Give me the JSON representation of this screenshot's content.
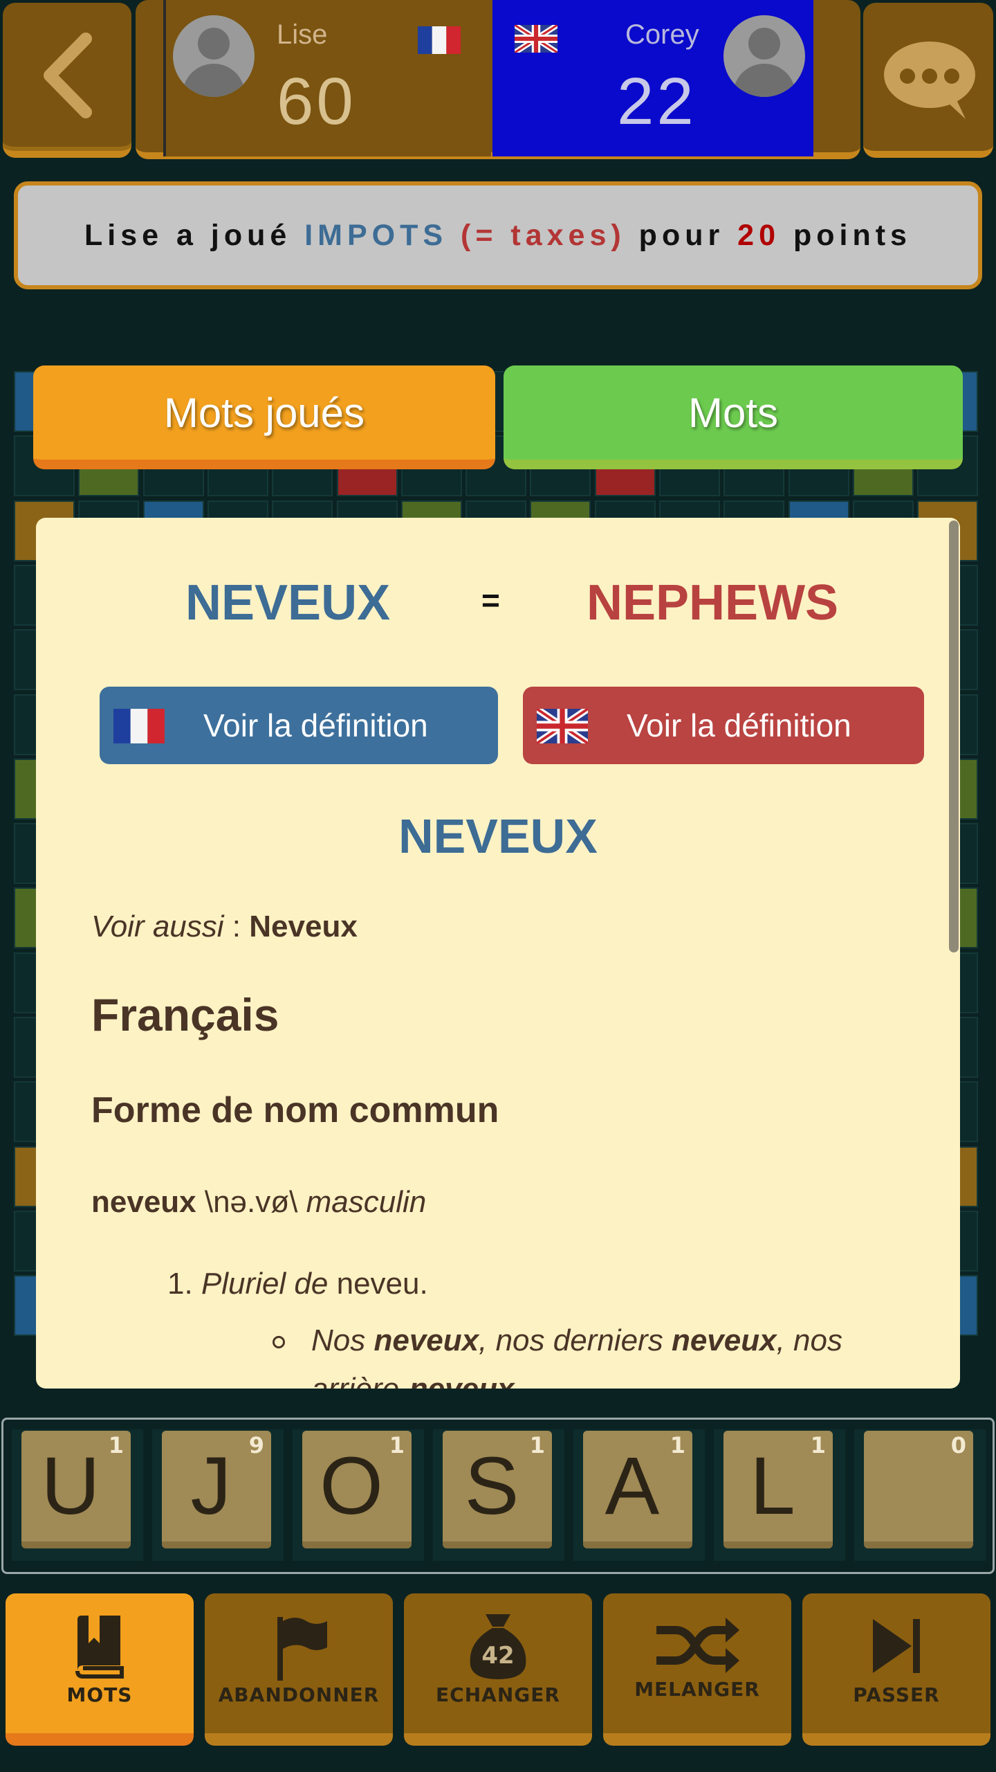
{
  "header": {
    "player1": {
      "name": "Lise",
      "score": "60",
      "flag": "fr-flag"
    },
    "player2": {
      "name": "Corey",
      "score": "22",
      "flag": "uk-flag"
    },
    "colors": {
      "player1_bg": "#7a5410",
      "player2_bg": "#0a0acc"
    }
  },
  "banner": {
    "prefix": "Lise a joué",
    "word": "IMPOTS",
    "meaning": "(= taxes)",
    "middle": "pour",
    "points": "20",
    "suffix": "points"
  },
  "tabs": {
    "played": "Mots joués",
    "words": "Mots"
  },
  "modal": {
    "word_fr": "NEVEUX",
    "equals": "=",
    "word_en": "NEPHEWS",
    "def_fr_label": "Voir la définition",
    "def_en_label": "Voir la définition",
    "def_title": "NEVEUX",
    "see_also_label": "Voir aussi",
    "see_also_sep": " : ",
    "see_also_word": "Neveux",
    "lang_heading": "Français",
    "form_heading": "Forme de nom commun",
    "entry_word": "neveux",
    "entry_pron": " \\nə.vø\\ ",
    "entry_gender": "masculin",
    "sense_num": "1.",
    "sense_lead": "Pluriel de",
    "sense_word": " neveu.",
    "ex_1": "Nos ",
    "ex_2": "neveux",
    "ex_3": ", nos derniers ",
    "ex_4": "neveux",
    "ex_5": ", nos arrière-",
    "ex_6": "neveux",
    "ex_7": "."
  },
  "rack": [
    {
      "letter": "U",
      "points": "1"
    },
    {
      "letter": "J",
      "points": "9"
    },
    {
      "letter": "O",
      "points": "1"
    },
    {
      "letter": "S",
      "points": "1"
    },
    {
      "letter": "A",
      "points": "1"
    },
    {
      "letter": "L",
      "points": "1"
    },
    {
      "letter": "",
      "points": "0"
    }
  ],
  "nav": {
    "words": "MOTS",
    "abandon": "ABANDONNER",
    "exchange": "ECHANGER",
    "bag_count": "42",
    "shuffle": "MELANGER",
    "pass": "PASSER"
  }
}
